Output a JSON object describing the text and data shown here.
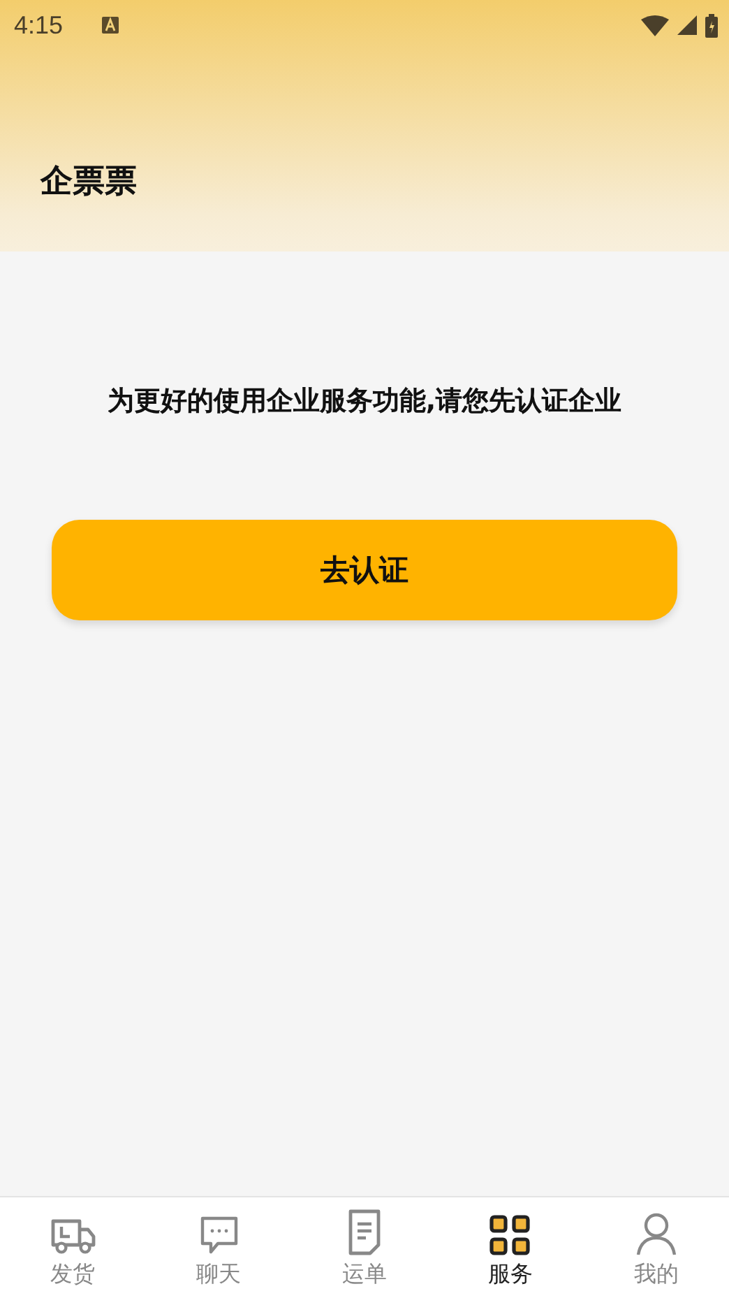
{
  "status_bar": {
    "time": "4:15"
  },
  "header": {
    "title": "企票票"
  },
  "message": "为更好的使用企业服务功能,请您先认证企业",
  "action_button": "去认证",
  "tabs": [
    {
      "kind": "truck",
      "label": "发货",
      "selected": false
    },
    {
      "kind": "chat",
      "label": "聊天",
      "selected": false
    },
    {
      "kind": "document",
      "label": "运单",
      "selected": false
    },
    {
      "kind": "grid",
      "label": "服务",
      "selected": true
    },
    {
      "kind": "person",
      "label": "我的",
      "selected": false
    }
  ]
}
